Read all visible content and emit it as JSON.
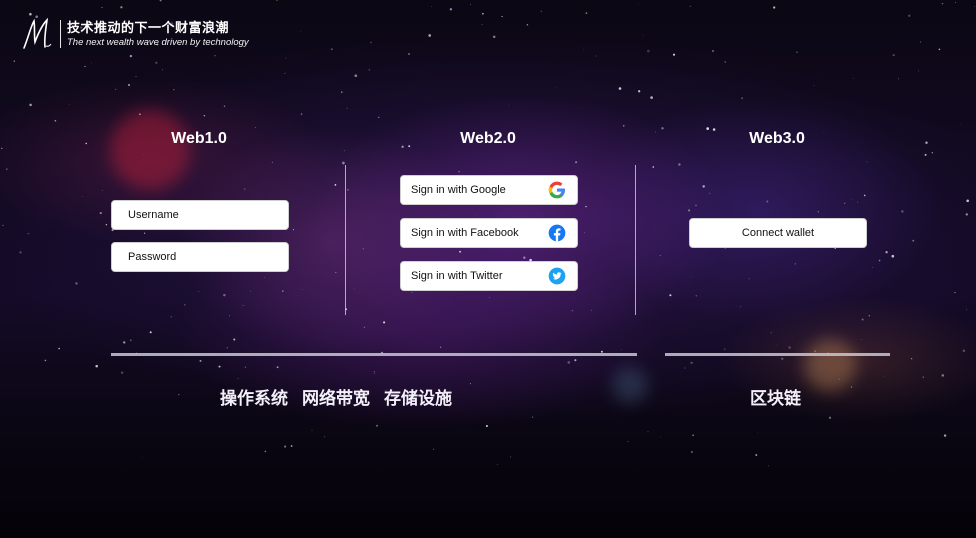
{
  "header": {
    "logo_icon": "m-signature-logo-icon",
    "title": "技术推动的下一个财富浪潮",
    "subtitle": "The next wealth wave driven by technology"
  },
  "columns": {
    "web1": {
      "title": "Web1.0",
      "username_placeholder": "Username",
      "password_placeholder": "Password"
    },
    "web2": {
      "title": "Web2.0",
      "google_label": "Sign in with Google",
      "google_icon": "google-icon",
      "facebook_label": "Sign in with Facebook",
      "facebook_icon": "facebook-icon",
      "twitter_label": "Sign in with Twitter",
      "twitter_icon": "twitter-icon"
    },
    "web3": {
      "title": "Web3.0",
      "connect_label": "Connect wallet"
    }
  },
  "footer": {
    "infra_labels": [
      "操作系统",
      "网络带宽",
      "存储设施"
    ],
    "chain_label": "区块链"
  },
  "colors": {
    "google_blue": "#4285F4",
    "google_red": "#EA4335",
    "google_yellow": "#FBBC05",
    "google_green": "#34A853",
    "facebook_blue": "#1877F2",
    "twitter_blue": "#1DA1F2"
  }
}
